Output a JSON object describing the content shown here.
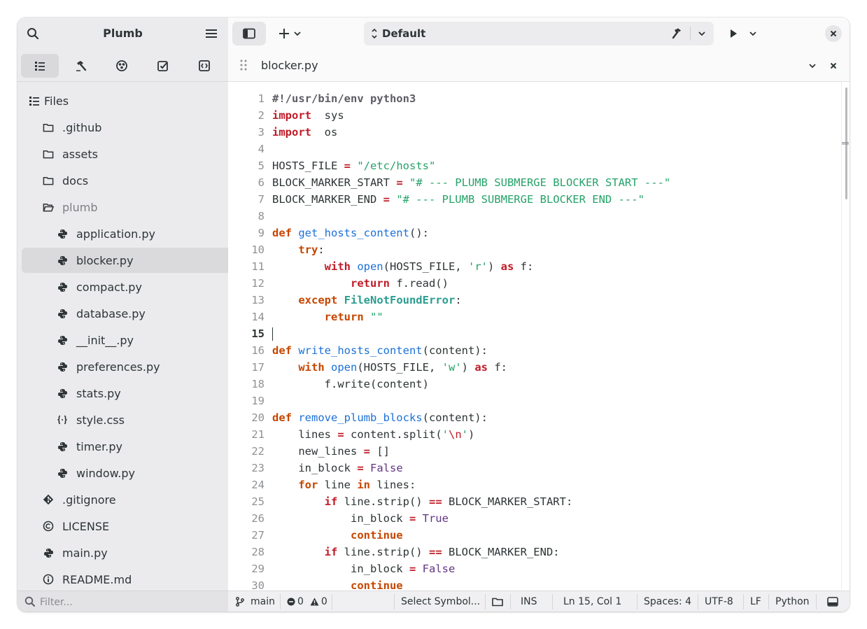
{
  "sidebar": {
    "title": "Plumb",
    "tabs": [
      "files",
      "build",
      "graph",
      "todo",
      "symbols"
    ],
    "tree": [
      {
        "label": "Files",
        "icon": "list-icon",
        "level": 0,
        "kind": "root"
      },
      {
        "label": ".github",
        "icon": "folder-icon",
        "level": 1
      },
      {
        "label": "assets",
        "icon": "folder-icon",
        "level": 1
      },
      {
        "label": "docs",
        "icon": "folder-icon",
        "level": 1
      },
      {
        "label": "plumb",
        "icon": "folder-open-icon",
        "level": 1,
        "dim": true
      },
      {
        "label": "application.py",
        "icon": "python-icon",
        "level": 2
      },
      {
        "label": "blocker.py",
        "icon": "python-icon",
        "level": 2,
        "selected": true
      },
      {
        "label": "compact.py",
        "icon": "python-icon",
        "level": 2
      },
      {
        "label": "database.py",
        "icon": "python-icon",
        "level": 2
      },
      {
        "label": "__init__.py",
        "icon": "python-icon",
        "level": 2
      },
      {
        "label": "preferences.py",
        "icon": "python-icon",
        "level": 2
      },
      {
        "label": "stats.py",
        "icon": "python-icon",
        "level": 2
      },
      {
        "label": "style.css",
        "icon": "css-icon",
        "level": 2
      },
      {
        "label": "timer.py",
        "icon": "python-icon",
        "level": 2
      },
      {
        "label": "window.py",
        "icon": "python-icon",
        "level": 2
      },
      {
        "label": ".gitignore",
        "icon": "git-icon",
        "level": 1
      },
      {
        "label": "LICENSE",
        "icon": "copyright-icon",
        "level": 1
      },
      {
        "label": "main.py",
        "icon": "python-icon",
        "level": 1
      },
      {
        "label": "README.md",
        "icon": "info-icon",
        "level": 1
      }
    ],
    "filter_placeholder": "Filter..."
  },
  "header": {
    "config_label": "Default"
  },
  "tab": {
    "title": "blocker.py"
  },
  "editor": {
    "current_line": 15,
    "lines": [
      [
        [
          "sh",
          "#!/usr/bin/env python3"
        ]
      ],
      [
        [
          "kw",
          "import"
        ],
        [
          "",
          "  sys"
        ]
      ],
      [
        [
          "kw",
          "import"
        ],
        [
          "",
          "  os"
        ]
      ],
      [],
      [
        [
          "",
          "HOSTS_FILE "
        ],
        [
          "op",
          "="
        ],
        [
          "",
          ""
        ],
        [
          "str",
          " \"/etc/hosts\""
        ]
      ],
      [
        [
          "",
          "BLOCK_MARKER_START "
        ],
        [
          "op",
          "="
        ],
        [
          "str",
          " \"# --- PLUMB SUBMERGE BLOCKER START ---\""
        ]
      ],
      [
        [
          "",
          "BLOCK_MARKER_END "
        ],
        [
          "op",
          "="
        ],
        [
          "str",
          " \"# --- PLUMB SUBMERGE BLOCKER END ---\""
        ]
      ],
      [],
      [
        [
          "kw2",
          "def"
        ],
        [
          "fn",
          " get_hosts_content"
        ],
        [
          "",
          "():"
        ]
      ],
      [
        [
          "",
          "    "
        ],
        [
          "kw2",
          "try"
        ],
        [
          "",
          ":"
        ]
      ],
      [
        [
          "",
          "        "
        ],
        [
          "kw",
          "with"
        ],
        [
          "bi",
          " open"
        ],
        [
          "",
          "(HOSTS_FILE, "
        ],
        [
          "str",
          "'r'"
        ],
        [
          "",
          ") "
        ],
        [
          "kw",
          "as"
        ],
        [
          "",
          ""
        ],
        [
          "",
          ""
        ],
        [
          "",
          " f:"
        ]
      ],
      [
        [
          "",
          "            "
        ],
        [
          "kw",
          "return"
        ],
        [
          "",
          " f.read()"
        ]
      ],
      [
        [
          "",
          "    "
        ],
        [
          "kw2",
          "except"
        ],
        [
          "cls",
          " FileNotFoundError"
        ],
        [
          "",
          ":"
        ]
      ],
      [
        [
          "",
          "        "
        ],
        [
          "kw2",
          "return"
        ],
        [
          "str",
          " \"\""
        ]
      ],
      [],
      [
        [
          "kw2",
          "def"
        ],
        [
          "fn",
          " write_hosts_content"
        ],
        [
          "",
          "(content):"
        ]
      ],
      [
        [
          "",
          "    "
        ],
        [
          "kw2",
          "with"
        ],
        [
          "bi",
          " open"
        ],
        [
          "",
          "(HOSTS_FILE, "
        ],
        [
          "str",
          "'w'"
        ],
        [
          "",
          ") "
        ],
        [
          "kw",
          "as"
        ],
        [
          "",
          " f:"
        ]
      ],
      [
        [
          "",
          "        f.write(content)"
        ]
      ],
      [],
      [
        [
          "kw2",
          "def"
        ],
        [
          "fn",
          " remove_plumb_blocks"
        ],
        [
          "",
          "(content):"
        ]
      ],
      [
        [
          "",
          "    lines "
        ],
        [
          "op",
          "="
        ],
        [
          "",
          " content.split("
        ],
        [
          "str",
          "'"
        ],
        [
          "esc",
          "\\n"
        ],
        [
          "str",
          "'"
        ],
        [
          "",
          ")"
        ]
      ],
      [
        [
          "",
          "    new_lines "
        ],
        [
          "op",
          "="
        ],
        [
          "",
          " []"
        ]
      ],
      [
        [
          "",
          "    in_block "
        ],
        [
          "op",
          "="
        ],
        [
          "const",
          " False"
        ]
      ],
      [
        [
          "",
          "    "
        ],
        [
          "kw2",
          "for"
        ],
        [
          "",
          " line "
        ],
        [
          "kw2",
          "in"
        ],
        [
          "",
          " lines:"
        ]
      ],
      [
        [
          "",
          "        "
        ],
        [
          "kw",
          "if"
        ],
        [
          "",
          " line.strip() "
        ],
        [
          "op",
          "=="
        ],
        [
          "",
          " BLOCK_MARKER_START:"
        ]
      ],
      [
        [
          "",
          "            in_block "
        ],
        [
          "op",
          "="
        ],
        [
          "const",
          " True"
        ]
      ],
      [
        [
          "",
          "            "
        ],
        [
          "kw2",
          "continue"
        ]
      ],
      [
        [
          "",
          "        "
        ],
        [
          "kw",
          "if"
        ],
        [
          "",
          " line.strip() "
        ],
        [
          "op",
          "=="
        ],
        [
          "",
          " BLOCK_MARKER_END:"
        ]
      ],
      [
        [
          "",
          "            in_block "
        ],
        [
          "op",
          "="
        ],
        [
          "const",
          " False"
        ]
      ],
      [
        [
          "",
          "            "
        ],
        [
          "kw2",
          "continue"
        ]
      ]
    ]
  },
  "status": {
    "branch": "main",
    "errors": "0",
    "warnings": "0",
    "symbol_selector": "Select Symbol...",
    "mode": "INS",
    "position": "Ln 15, Col 1",
    "indent": "Spaces: 4",
    "encoding": "UTF-8",
    "line_ending": "LF",
    "language": "Python"
  },
  "colors": {
    "sidebar_bg": "#ebebed",
    "keyword": "#c01c28",
    "function": "#1c71d8",
    "string": "#26a269"
  }
}
